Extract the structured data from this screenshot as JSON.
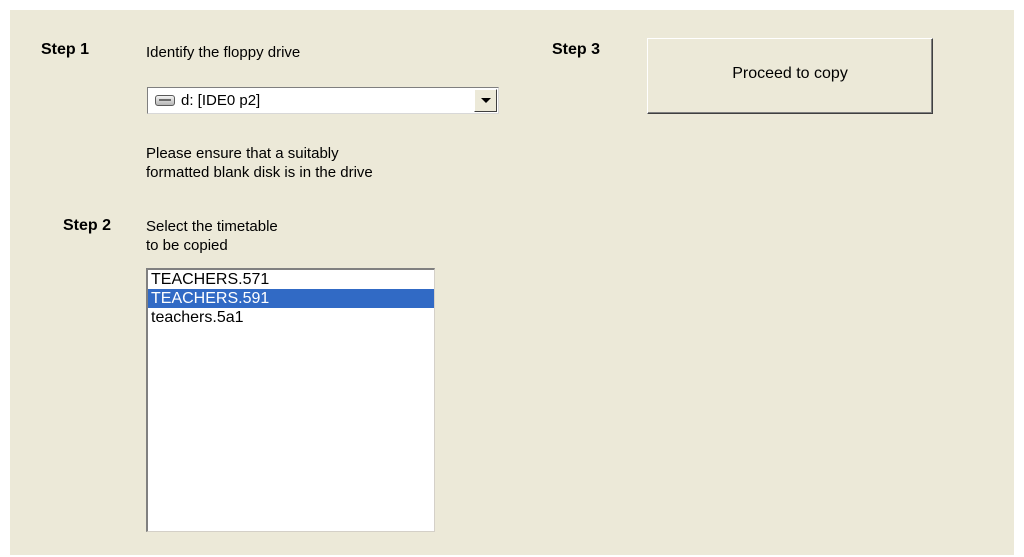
{
  "steps": {
    "step1": {
      "label": "Step 1",
      "instruction": "Identify the floppy drive",
      "drive_selected": "d: [IDE0 p2]",
      "drive_icon": "drive-icon",
      "note_line1": "Please ensure that a suitably",
      "note_line2": "formatted blank disk is in the drive"
    },
    "step2": {
      "label": "Step 2",
      "instruction_line1": "Select the timetable",
      "instruction_line2": "to be copied",
      "files": [
        {
          "name": "TEACHERS.571",
          "selected": false
        },
        {
          "name": "TEACHERS.591",
          "selected": true
        },
        {
          "name": "teachers.5a1",
          "selected": false
        }
      ]
    },
    "step3": {
      "label": "Step 3",
      "button_label": "Proceed to copy"
    }
  },
  "colors": {
    "panel_bg": "#ece9d8",
    "selection_bg": "#316ac5",
    "selection_fg": "#ffffff"
  }
}
